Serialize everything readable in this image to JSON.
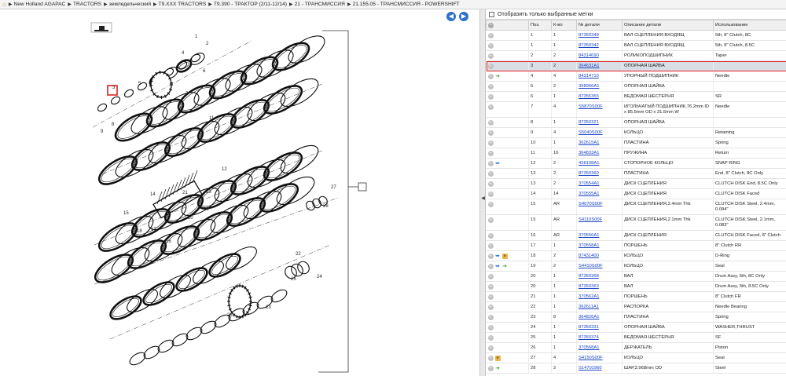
{
  "breadcrumb": [
    "New Holland AGAPAC",
    "TRACTORS",
    "земледельческий",
    "T9.XXX TRACTORS",
    "T9.390 - ТРАКТОР (2/11-12/14)",
    "21 - ТРАНСМИССИЯ",
    "21.155.05 - ТРАНСМИССИЯ - POWERSHIFT"
  ],
  "filter": {
    "label": "Отобразить только выбранные метки"
  },
  "table": {
    "headers": [
      "Поз.",
      "К-во",
      "№ детали",
      "Описание детали",
      "Использование"
    ],
    "rows": [
      {
        "pos": "1",
        "qty": "1",
        "part": "87350349",
        "desc": "ВАЛ СЦЕПЛЕНИЯ ВХОДЯЩ",
        "use": "5th, 8\" Clutch, 8C",
        "icons": ""
      },
      {
        "pos": "1",
        "qty": "1",
        "part": "87350342",
        "desc": "ВАЛ СЦЕПЛЕНИЯ ВХОДЯЩ",
        "use": "5th, 8\" Clutch, 8.5C",
        "icons": ""
      },
      {
        "pos": "2",
        "qty": "2",
        "part": "84314690",
        "desc": "РОЛИКОПОДШИПНИК",
        "use": "Taper",
        "icons": ""
      },
      {
        "pos": "3",
        "qty": "2",
        "part": "364631A1",
        "desc": "ОПОРНАЯ ШАЙБА",
        "use": "",
        "icons": "",
        "selected": true
      },
      {
        "pos": "4",
        "qty": "4",
        "part": "84314710",
        "desc": "УПОРНЫЙ ПОДШИПНИК",
        "use": "Needle",
        "icons": "green"
      },
      {
        "pos": "5",
        "qty": "2",
        "part": "358966A1",
        "desc": "ОПОРНАЯ ШАЙБА",
        "use": "",
        "icons": ""
      },
      {
        "pos": "6",
        "qty": "1",
        "part": "87355355",
        "desc": "ВЕДОМАЯ ШЕСТЕРНЯ",
        "use": "SR",
        "icons": ""
      },
      {
        "pos": "7",
        "qty": "4",
        "part": "S5870S00F",
        "desc": "ИГОЛЬЧАТЫЙ ПОДШИПНИК,76.2mm ID x 85.5mm OD x 31.5mm W",
        "use": "Needle",
        "icons": ""
      },
      {
        "pos": "8",
        "qty": "1",
        "part": "87350321",
        "desc": "ОПОРНАЯ ШАЙБА",
        "use": "",
        "icons": ""
      },
      {
        "pos": "9",
        "qty": "4",
        "part": "S5040S00F",
        "desc": "КОЛЬЦО",
        "use": "Retaining",
        "icons": ""
      },
      {
        "pos": "10",
        "qty": "1",
        "part": "362615A1",
        "desc": "ПЛАСТИНА",
        "use": "Spring",
        "icons": ""
      },
      {
        "pos": "11",
        "qty": "16",
        "part": "364833A1",
        "desc": "ПРУЖИНА",
        "use": "Return",
        "icons": ""
      },
      {
        "pos": "12",
        "qty": "2",
        "part": "428108A1",
        "desc": "СТОПОРНОЕ КОЛЬЦО",
        "use": "SNAP RING",
        "icons": "blue"
      },
      {
        "pos": "13",
        "qty": "2",
        "part": "87350360",
        "desc": "ПЛАСТИНА",
        "use": "End, 8\" Clutch, 8C Only",
        "icons": ""
      },
      {
        "pos": "13",
        "qty": "2",
        "part": "370554A1",
        "desc": "ДИСК СЦЕПЛЕНИЯ",
        "use": "CLUTCH DISK End, 8.5C Only",
        "icons": ""
      },
      {
        "pos": "14",
        "qty": "14",
        "part": "370555A1",
        "desc": "ДИСК СЦЕПЛЕНИЯ",
        "use": "CLUTCH DISK Faced",
        "icons": ""
      },
      {
        "pos": "15",
        "qty": "AR",
        "part": "S4070S00F",
        "desc": "ДИСК СЦЕПЛЕНИЯ,2.4mm Thk",
        "use": "CLUTCH DISK Steel, 2.4mm, 0.094\"",
        "icons": ""
      },
      {
        "pos": "15",
        "qty": "AR",
        "part": "S4110S00F",
        "desc": "ДИСК СЦЕПЛЕНИЯ,2.1mm Thk",
        "use": "CLUTCH DISK Steel, 2.1mm, 0.083\"",
        "icons": ""
      },
      {
        "pos": "16",
        "qty": "AR",
        "part": "370556A1",
        "desc": "ДИСК СЦЕПЛЕНИЯ",
        "use": "CLUTCH DISK Faced, 8\" Clutch",
        "icons": ""
      },
      {
        "pos": "17",
        "qty": "1",
        "part": "370558A1",
        "desc": "ПОРШЕНЬ",
        "use": "8\" Clutch RR",
        "icons": ""
      },
      {
        "pos": "18",
        "qty": "2",
        "part": "87431400",
        "desc": "КОЛЬЦО",
        "use": "D-Ring",
        "icons": "blue-box"
      },
      {
        "pos": "19",
        "qty": "2",
        "part": "S4410S00F",
        "desc": "КОЛЬЦО",
        "use": "Seal",
        "icons": "blue-green"
      },
      {
        "pos": "20",
        "qty": "1",
        "part": "87350368",
        "desc": "ВАЛ",
        "use": "Drum Assy, 5th, 8C Only",
        "icons": ""
      },
      {
        "pos": "20",
        "qty": "1",
        "part": "87350363",
        "desc": "ВАЛ",
        "use": "Drum Assy, 5th, 8.5C Only",
        "icons": ""
      },
      {
        "pos": "21",
        "qty": "1",
        "part": "370562A1",
        "desc": "ПОРШЕНЬ",
        "use": "8\" Clutch FR",
        "icons": ""
      },
      {
        "pos": "22",
        "qty": "1",
        "part": "362611A1",
        "desc": "РАСПОРКА",
        "use": "Needle Bearing",
        "icons": ""
      },
      {
        "pos": "23",
        "qty": "8",
        "part": "364826A1",
        "desc": "ПЛАСТИНА",
        "use": "Spring",
        "icons": ""
      },
      {
        "pos": "24",
        "qty": "1",
        "part": "87350331",
        "desc": "ОПОРНАЯ ШАЙБА",
        "use": "WASHER,THRUST",
        "icons": ""
      },
      {
        "pos": "25",
        "qty": "1",
        "part": "87350374",
        "desc": "ВЕДОМАЯ ШЕСТЕРНЯ",
        "use": "SF",
        "icons": ""
      },
      {
        "pos": "26",
        "qty": "1",
        "part": "370568A1",
        "desc": "ДЕРЖАТЕЛЬ",
        "use": "Piston",
        "icons": ""
      },
      {
        "pos": "27",
        "qty": "4",
        "part": "S4150S00F",
        "desc": "КОЛЬЦО",
        "use": "Seal",
        "icons": "box"
      },
      {
        "pos": "28",
        "qty": "2",
        "part": "S14701960",
        "desc": "ШАР,3.968mm OD",
        "use": "Steel",
        "icons": "green"
      }
    ]
  },
  "diagram": {
    "labels": [
      "1",
      "2",
      "3",
      "4",
      "5",
      "6",
      "7",
      "8",
      "9",
      "10",
      "11",
      "12",
      "13",
      "14",
      "15",
      "16",
      "17",
      "18",
      "19",
      "20",
      "21",
      "22",
      "23",
      "24",
      "25",
      "26",
      "27",
      "28"
    ],
    "highlight": "3"
  }
}
